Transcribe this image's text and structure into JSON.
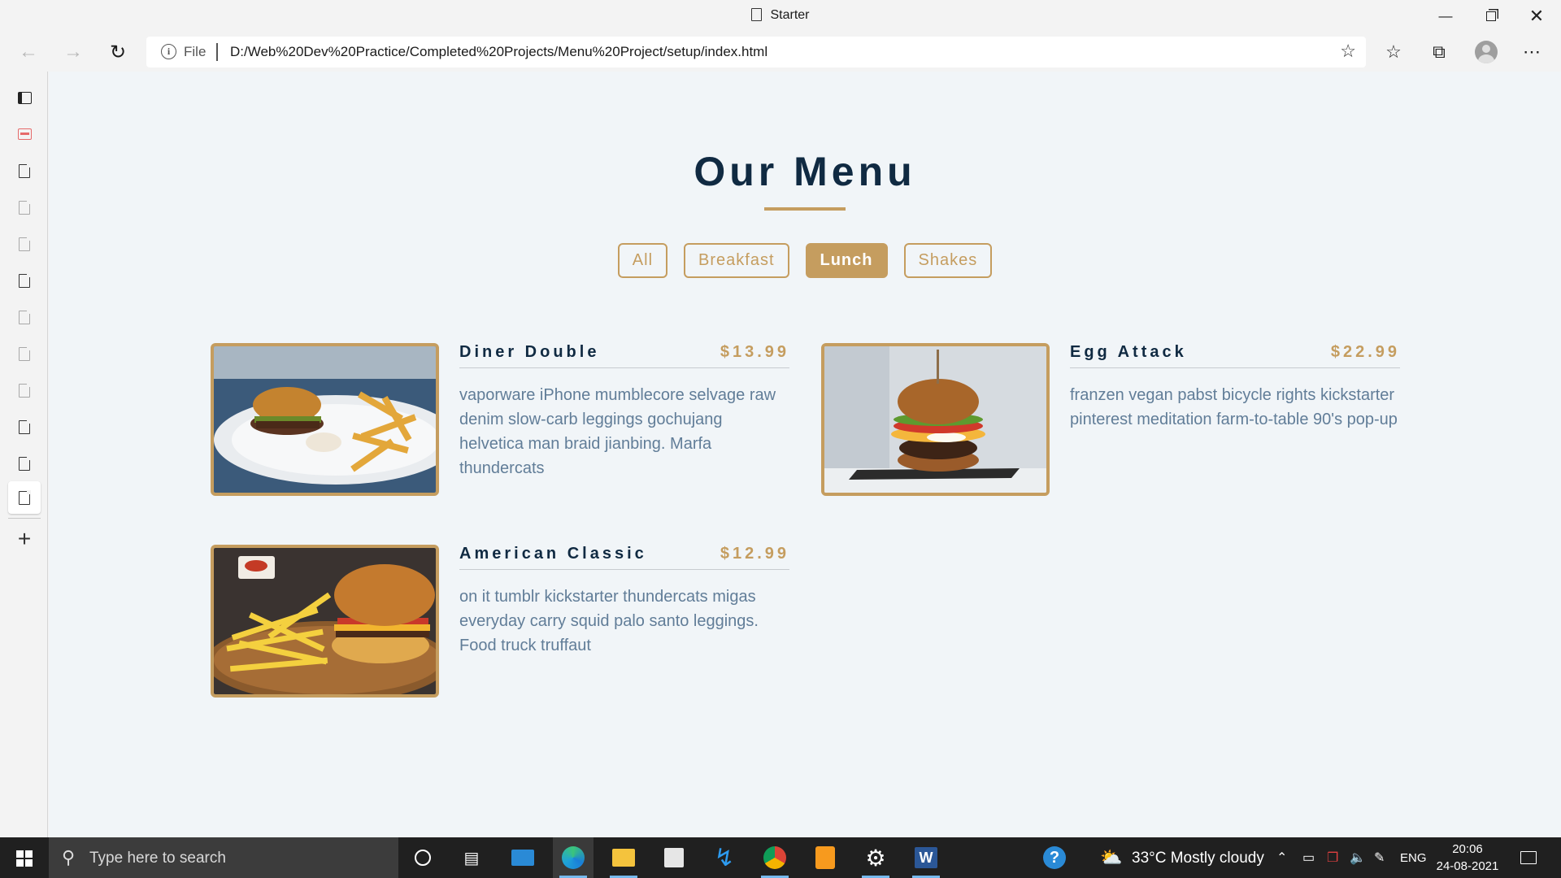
{
  "window": {
    "title": "Starter"
  },
  "address_bar": {
    "scheme": "File",
    "url": "D:/Web%20Dev%20Practice/Completed%20Projects/Menu%20Project/setup/index.html"
  },
  "menu": {
    "title": "Our Menu",
    "filters": [
      "All",
      "Breakfast",
      "Lunch",
      "Shakes"
    ],
    "active_filter": "Lunch",
    "items": [
      {
        "name": "Diner Double",
        "price": "$13.99",
        "description": "vaporware iPhone mumblecore selvage raw denim slow-carb leggings gochujang helvetica man braid jianbing. Marfa thundercats"
      },
      {
        "name": "Egg Attack",
        "price": "$22.99",
        "description": "franzen vegan pabst bicycle rights kickstarter pinterest meditation farm-to-table 90's pop-up"
      },
      {
        "name": "American Classic",
        "price": "$12.99",
        "description": "on it tumblr kickstarter thundercats migas everyday carry squid palo santo leggings. Food truck truffaut"
      }
    ],
    "colors": {
      "primary": "#c59d5f",
      "heading": "#102a42",
      "text": "#617d98",
      "background": "#f1f5f8"
    }
  },
  "taskbar": {
    "search_placeholder": "Type here to search",
    "weather": "33°C  Mostly cloudy",
    "language": "ENG",
    "time": "20:06",
    "date": "24-08-2021"
  }
}
